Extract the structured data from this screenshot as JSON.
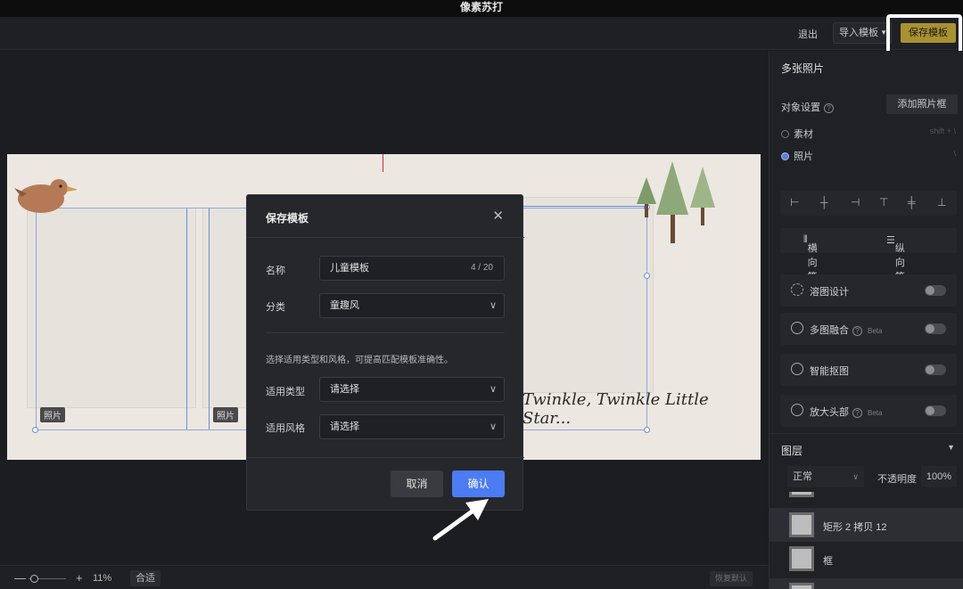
{
  "app": {
    "title": "像素苏打"
  },
  "topbar": {
    "exit_label": "退出",
    "import_label": "导入模板",
    "save_label": "保存模板"
  },
  "canvas": {
    "photo_tag_1": "照片",
    "photo_tag_2": "照片",
    "caption": "Twinkle, Twinkle Little Star..."
  },
  "bottombar": {
    "zoom_minus": "—",
    "zoom_plus": "+",
    "zoom_value": "11%",
    "fit_label": "合适",
    "reset_label": "恢复默认"
  },
  "sidebar": {
    "title": "多张照片",
    "object_settings": "对象设置",
    "help_glyph": "?",
    "add_frame_label": "添加照片框",
    "radio_material": "素材",
    "radio_photo": "照片",
    "shortcut_material": "shift + \\",
    "shortcut_photo": "\\",
    "dist_h": "横向等距",
    "dist_v": "纵向等距",
    "features": [
      {
        "label": "溶图设计",
        "badge": ""
      },
      {
        "label": "多图融合",
        "badge": "Beta"
      },
      {
        "label": "智能抠图",
        "badge": ""
      },
      {
        "label": "放大头部",
        "badge": "Beta"
      }
    ],
    "layers_title": "图层",
    "blend_mode": "正常",
    "opacity_label": "不透明度",
    "opacity_value": "100%",
    "layers": [
      {
        "name": "矩形 2 拷贝 12"
      },
      {
        "name": "框"
      }
    ]
  },
  "modal": {
    "title": "保存模板",
    "close_glyph": "✕",
    "name_label": "名称",
    "name_value": "儿童模板",
    "name_count": "4 / 20",
    "category_label": "分类",
    "category_value": "童趣风",
    "hint": "选择适用类型和风格，可提高匹配模板准确性。",
    "type_label": "适用类型",
    "type_value": "请选择",
    "style_label": "适用风格",
    "style_value": "请选择",
    "cancel_label": "取消",
    "confirm_label": "确认"
  },
  "colors": {
    "accent_save": "#a99131",
    "confirm_blue": "#4c7cf3",
    "frame_blue": "#6a8fd6"
  }
}
